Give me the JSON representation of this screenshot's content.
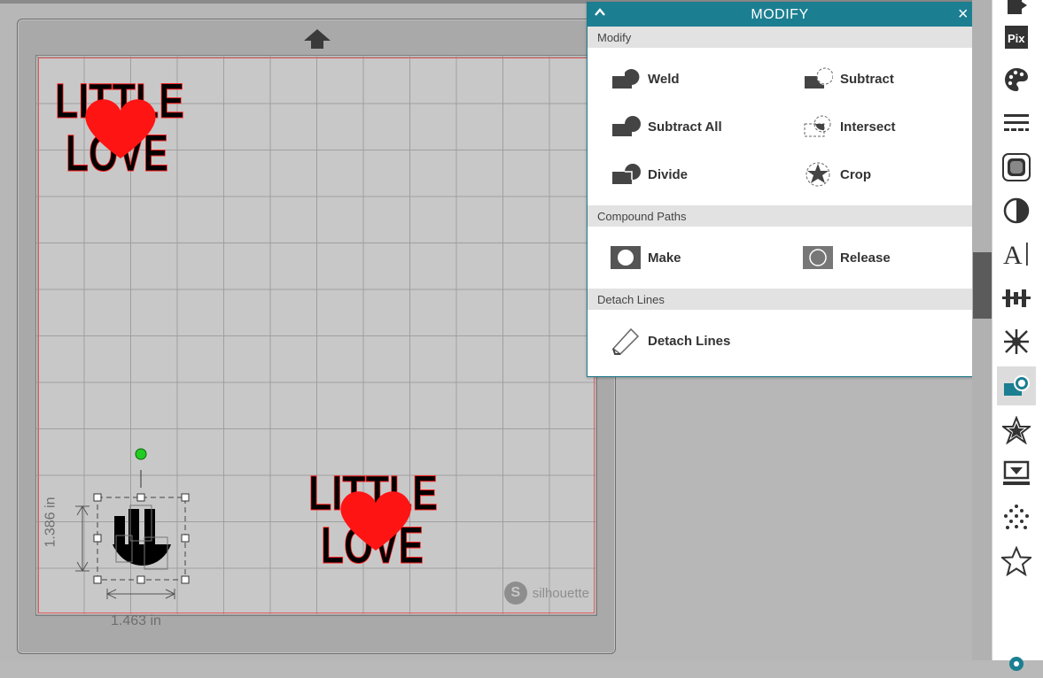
{
  "panel": {
    "title": "MODIFY",
    "sections": {
      "modify": "Modify",
      "compound": "Compound Paths",
      "detach": "Detach Lines"
    },
    "buttons": {
      "weld": "Weld",
      "subtract": "Subtract",
      "subtract_all": "Subtract All",
      "intersect": "Intersect",
      "divide": "Divide",
      "crop": "Crop",
      "make": "Make",
      "release": "Release",
      "detach_lines": "Detach Lines"
    }
  },
  "canvas": {
    "design_text_line1": "LITTLE",
    "design_text_line2": "LOVE",
    "height_dimension": "1.386 in",
    "width_dimension": "1.463 in",
    "brand": "silhouette"
  },
  "toolbar_icons": [
    "page-setup-icon",
    "pixscan-icon",
    "fill-palette-icon",
    "line-style-icon",
    "offset-icon",
    "trace-icon",
    "text-style-icon",
    "align-icon",
    "transform-icon",
    "modify-icon",
    "star-library-icon",
    "design-store-icon",
    "rhinestone-icon",
    "favorite-star-icon",
    "settings-gear-icon"
  ],
  "colors": {
    "panel_header": "#1b7f91",
    "heart_red": "#ff1414",
    "selection_handle": "#22cc22"
  }
}
